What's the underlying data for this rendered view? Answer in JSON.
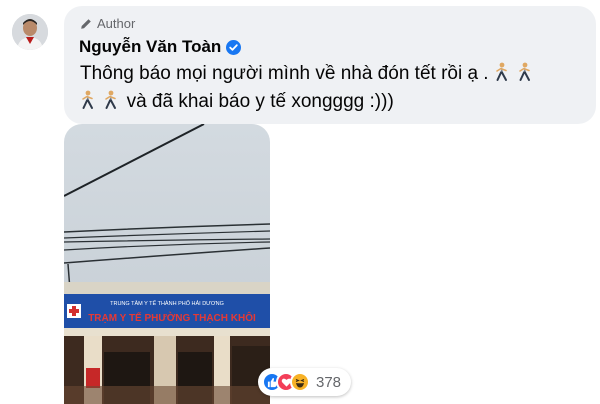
{
  "comment": {
    "badge_label": "Author",
    "author_name": "Nguyễn Văn Toàn",
    "text_line1": "Thông báo mọi người mình về nhà đón tết rồi ạ .",
    "text_line2": "và đã khai báo y tế xongggg :)))",
    "emoji_icon": "person-walking-emoji"
  },
  "photo": {
    "sign_small_text": "TRUNG TÂM Y TẾ THÀNH PHỐ HẢI DƯƠNG",
    "sign_main_text": "TRẠM Y TẾ PHƯỜNG THẠCH KHÔI"
  },
  "reactions": {
    "icons": [
      "like-icon",
      "love-icon",
      "haha-icon"
    ],
    "count": "378"
  },
  "colors": {
    "bubble": "#eff1f4",
    "verified": "#1877f2",
    "secondary_text": "#65676b"
  }
}
